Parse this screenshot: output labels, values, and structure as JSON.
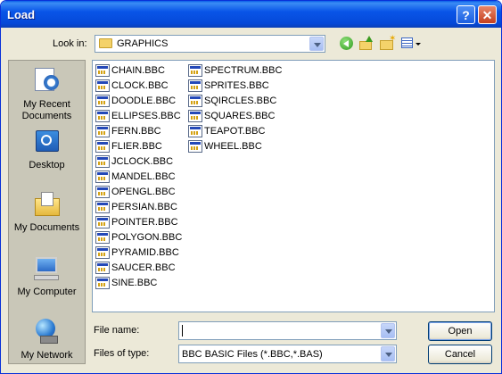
{
  "window": {
    "title": "Load"
  },
  "toolbar": {
    "look_in_label": "Look in:",
    "look_in_value": "GRAPHICS"
  },
  "places": [
    {
      "label_lines": [
        "My Recent",
        "Documents"
      ]
    },
    {
      "label_lines": [
        "Desktop"
      ]
    },
    {
      "label_lines": [
        "My Documents"
      ]
    },
    {
      "label_lines": [
        "My Computer"
      ]
    },
    {
      "label_lines": [
        "My Network"
      ]
    }
  ],
  "files": {
    "column1": [
      "CHAIN.BBC",
      "CLOCK.BBC",
      "DOODLE.BBC",
      "ELLIPSES.BBC",
      "FERN.BBC",
      "FLIER.BBC",
      "JCLOCK.BBC",
      "MANDEL.BBC",
      "OPENGL.BBC",
      "PERSIAN.BBC",
      "POINTER.BBC",
      "POLYGON.BBC",
      "PYRAMID.BBC",
      "SAUCER.BBC",
      "SINE.BBC"
    ],
    "column2": [
      "SPECTRUM.BBC",
      "SPRITES.BBC",
      "SQIRCLES.BBC",
      "SQUARES.BBC",
      "TEAPOT.BBC",
      "WHEEL.BBC"
    ]
  },
  "form": {
    "file_name_label": "File name:",
    "file_name_value": "",
    "files_of_type_label": "Files of type:",
    "files_of_type_value": "BBC BASIC Files (*.BBC,*.BAS)"
  },
  "buttons": {
    "open": "Open",
    "cancel": "Cancel"
  },
  "colors": {
    "title_bar": "#0a55e8",
    "places_bar": "#c9c7b8",
    "dialog_bg": "#ece9d8"
  }
}
